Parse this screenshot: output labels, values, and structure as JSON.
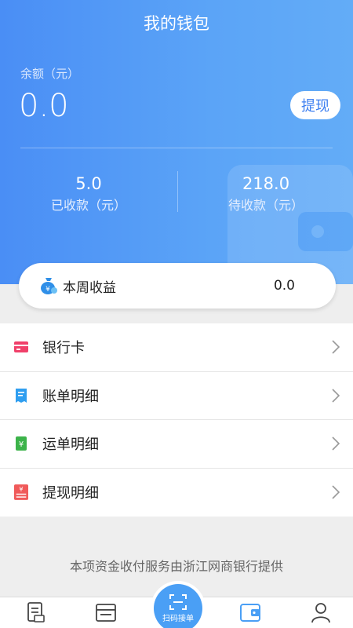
{
  "header": {
    "title": "我的钱包",
    "balance_label": "余额（元）",
    "balance_value": "0.0",
    "withdraw_label": "提现",
    "received": {
      "value": "5.0",
      "label": "已收款（元）"
    },
    "pending": {
      "value": "218.0",
      "label": "待收款（元）"
    }
  },
  "weekly": {
    "label": "本周收益",
    "value": "0.0",
    "icon": "money-bag-icon"
  },
  "menu": [
    {
      "label": "银行卡",
      "icon": "bank-card-icon",
      "color": "#f0406a"
    },
    {
      "label": "账单明细",
      "icon": "bill-icon",
      "color": "#2f9ef0"
    },
    {
      "label": "运单明细",
      "icon": "yen-waybill-icon",
      "color": "#3cb34a"
    },
    {
      "label": "提现明细",
      "icon": "withdraw-record-icon",
      "color": "#f05a5a"
    }
  ],
  "footer_note": "本项资金收付服务由浙江网商银行提供",
  "tabbar": {
    "scan_label": "扫码接单",
    "tabs": [
      "orders-icon",
      "waybill-icon",
      "wallet-icon",
      "profile-icon"
    ],
    "active_color": "#4a9ff5"
  }
}
